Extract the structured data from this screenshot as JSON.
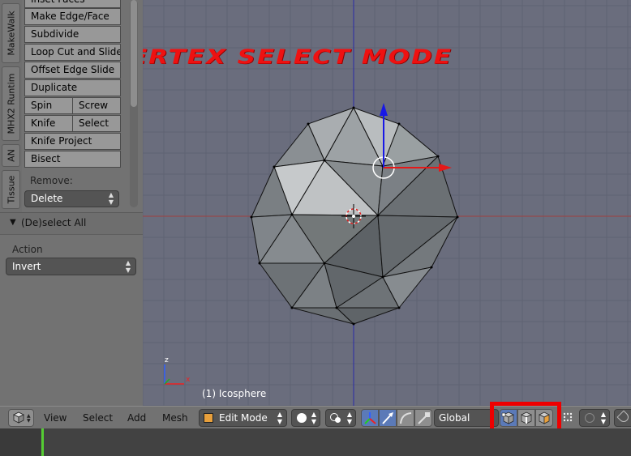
{
  "overlay_title": "VERTEX SELECT MODE",
  "tabs": [
    "MakeWalk",
    "MHX2 Runtim",
    "AN",
    "Tissue"
  ],
  "tool_shelf": {
    "top_partial": "Inset Faces",
    "buttons": {
      "make_edge_face": "Make Edge/Face",
      "subdivide": "Subdivide",
      "loop_cut": "Loop Cut and Slide",
      "offset_edge": "Offset Edge Slide",
      "duplicate": "Duplicate",
      "spin": "Spin",
      "screw": "Screw",
      "knife": "Knife",
      "select": "Select",
      "knife_project": "Knife Project",
      "bisect": "Bisect"
    },
    "remove_label": "Remove:",
    "delete_value": "Delete"
  },
  "operator_panel": {
    "title": "(De)select All",
    "action_label": "Action",
    "action_value": "Invert"
  },
  "viewport": {
    "object_label": "(1) Icosphere",
    "axis_z": "z",
    "axis_x": "x"
  },
  "header": {
    "menus": [
      "View",
      "Select",
      "Add",
      "Mesh"
    ],
    "mode": "Edit Mode",
    "orientation": "Global"
  },
  "colors": {
    "overlay_text": "#ee1111",
    "highlight_box": "#ee0000",
    "viewport_bg": "#6a6d7d",
    "timeline_marker": "#55cc33"
  }
}
